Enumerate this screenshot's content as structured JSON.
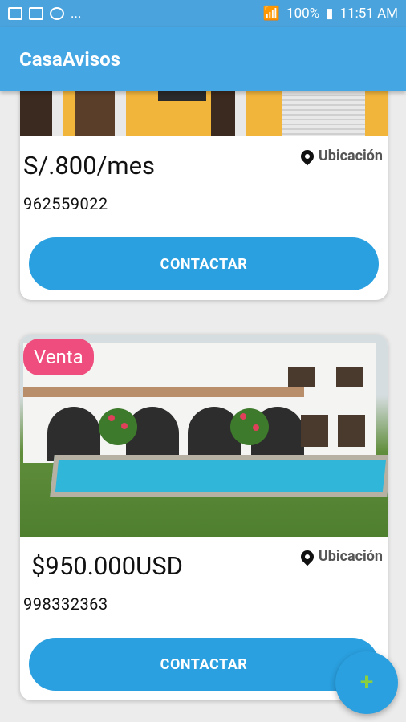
{
  "status_bar": {
    "left_more": "...",
    "battery": "100%",
    "time": "11:51 AM"
  },
  "app_bar": {
    "title": "CasaAvisos"
  },
  "listings": [
    {
      "price": "S/.800/mes",
      "location_label": "Ubicación",
      "phone": "962559022",
      "button_label": "CONTACTAR"
    },
    {
      "badge": "Venta",
      "price": "$950.000USD",
      "location_label": "Ubicación",
      "phone": "998332363",
      "button_label": "CONTACTAR"
    }
  ],
  "fab": {
    "icon": "plus-icon",
    "glyph": "+",
    "color": "#8bcf3f"
  },
  "colors": {
    "app_bar": "#44a6e3",
    "status_bar": "#4aa3dc",
    "button": "#2aa0e0",
    "badge": "#ef4d7e"
  }
}
